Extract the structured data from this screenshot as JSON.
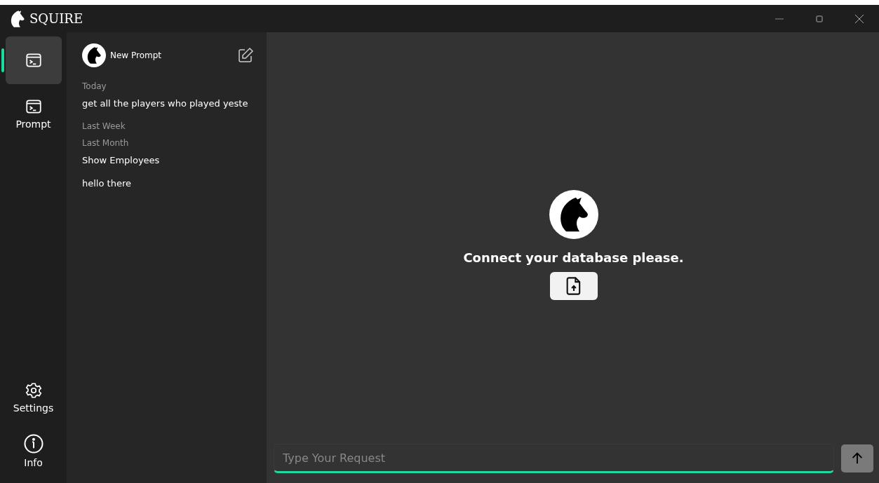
{
  "window": {
    "title": "SQUIRE"
  },
  "rail": {
    "top": [
      {
        "selected": true
      },
      {
        "label": "Prompt",
        "selected": false
      }
    ],
    "bottom": [
      {
        "label": "Settings",
        "selected": false
      },
      {
        "label": "Info",
        "selected": false
      }
    ]
  },
  "history": {
    "new_prompt": "New Prompt",
    "groups": [
      {
        "heading": "Today",
        "items": [
          "get all the players who played yeste"
        ]
      },
      {
        "heading": "Last Week"
      },
      {
        "heading": "Last Month",
        "items": [
          "Show Employees",
          "hello there"
        ]
      }
    ]
  },
  "main": {
    "message": "Connect your database please."
  },
  "request": {
    "placeholder": "Type Your Request"
  }
}
